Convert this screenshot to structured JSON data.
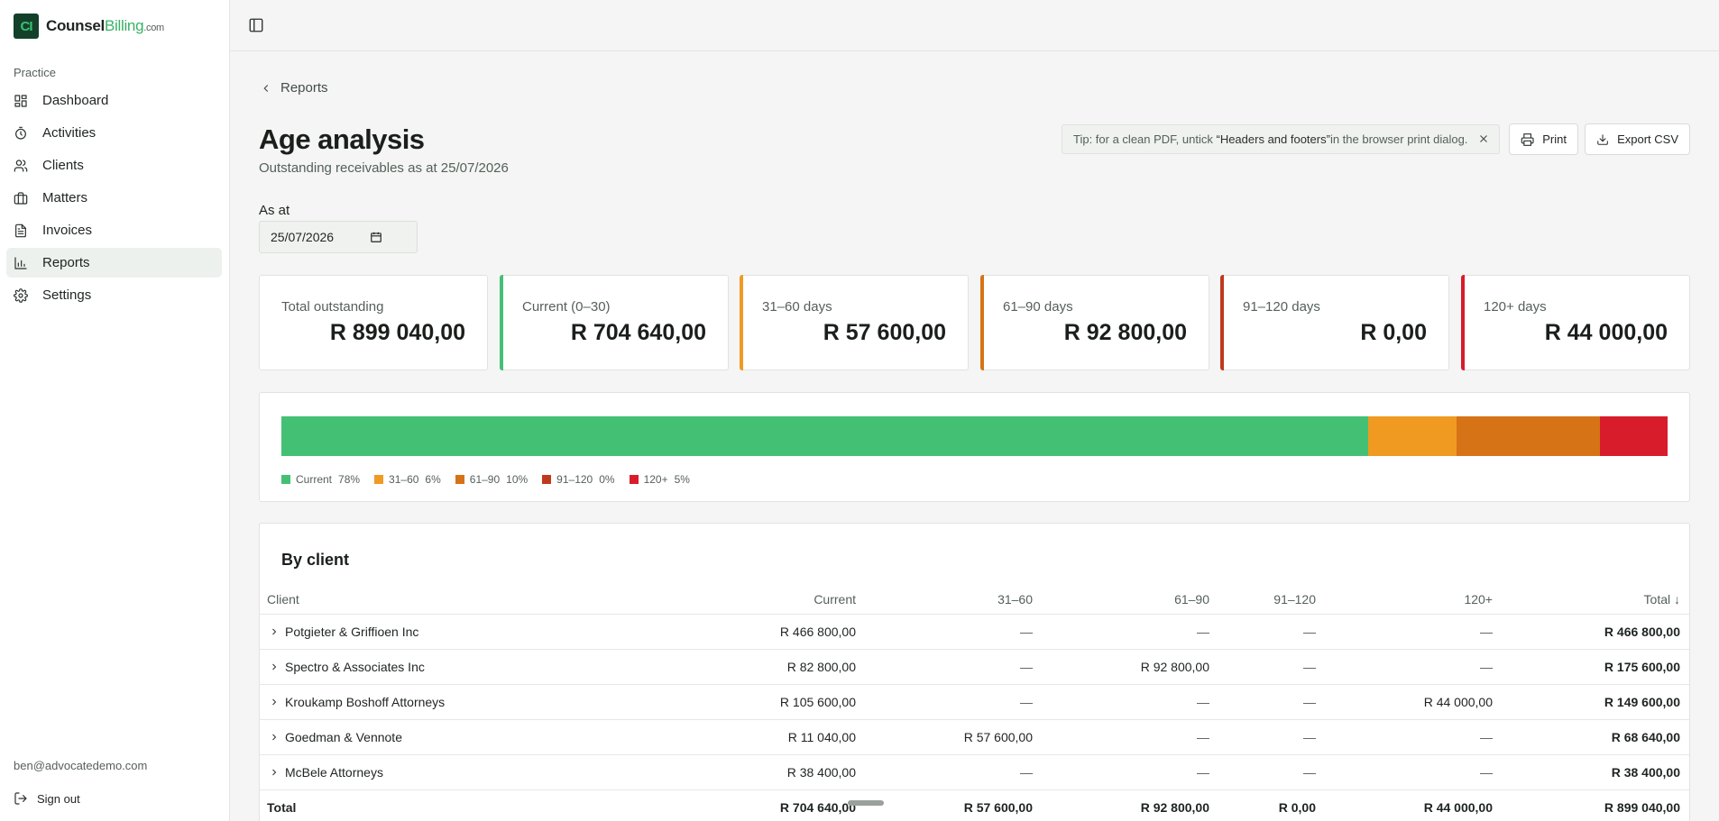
{
  "brand": {
    "mark": "CI",
    "name_part1": "Counsel",
    "name_part2": "Billing",
    "name_suffix": ".com"
  },
  "sidebar": {
    "section_label": "Practice",
    "items": [
      {
        "label": "Dashboard",
        "icon": "dashboard-icon"
      },
      {
        "label": "Activities",
        "icon": "stopwatch-icon"
      },
      {
        "label": "Clients",
        "icon": "users-icon"
      },
      {
        "label": "Matters",
        "icon": "briefcase-icon"
      },
      {
        "label": "Invoices",
        "icon": "document-icon"
      },
      {
        "label": "Reports",
        "icon": "bar-chart-icon",
        "active": true
      },
      {
        "label": "Settings",
        "icon": "gear-icon"
      }
    ],
    "user_email": "ben@advocatedemo.com",
    "signout_label": "Sign out"
  },
  "page": {
    "back_label": "Reports",
    "title": "Age analysis",
    "subtitle": "Outstanding receivables as at 25/07/2026",
    "tip_prefix": "Tip: for a clean PDF, untick ",
    "tip_highlight": "“Headers and footers”",
    "tip_suffix": " in the browser print dialog.",
    "print_label": "Print",
    "export_label": "Export CSV",
    "as_at_label": "As at",
    "as_at_value": "25/07/2026"
  },
  "summary_cards": [
    {
      "label": "Total outstanding",
      "value": "R 899 040,00",
      "color": ""
    },
    {
      "label": "Current (0–30)",
      "value": "R 704 640,00",
      "color": "#44c075"
    },
    {
      "label": "31–60 days",
      "value": "R 57 600,00",
      "color": "#f09a22"
    },
    {
      "label": "61–90 days",
      "value": "R 92 800,00",
      "color": "#d67316"
    },
    {
      "label": "91–120 days",
      "value": "R 0,00",
      "color": "#bf3a1c"
    },
    {
      "label": "120+ days",
      "value": "R 44 000,00",
      "color": "#d81c2c"
    }
  ],
  "chart_data": {
    "type": "bar",
    "stacked": true,
    "orientation": "horizontal",
    "categories": [
      "Current",
      "31–60",
      "61–90",
      "91–120",
      "120+"
    ],
    "values": [
      704640,
      57600,
      92800,
      0,
      44000
    ],
    "percent_labels": [
      "78%",
      "6%",
      "10%",
      "0%",
      "5%"
    ],
    "colors": [
      "#44c075",
      "#f09a22",
      "#d67316",
      "#bf3a1c",
      "#d81c2c"
    ],
    "legend_position": "bottom-left"
  },
  "table": {
    "title": "By client",
    "columns": [
      "Client",
      "Current",
      "31–60",
      "61–90",
      "91–120",
      "120+",
      "Total ↓"
    ],
    "rows": [
      {
        "client": "Potgieter & Griffioen Inc",
        "current": "R 466 800,00",
        "d31_60": "—",
        "d61_90": "—",
        "d91_120": "—",
        "d120": "—",
        "total": "R 466 800,00"
      },
      {
        "client": "Spectro & Associates Inc",
        "current": "R 82 800,00",
        "d31_60": "—",
        "d61_90": "R 92 800,00",
        "d91_120": "—",
        "d120": "—",
        "total": "R 175 600,00"
      },
      {
        "client": "Kroukamp Boshoff Attorneys",
        "current": "R 105 600,00",
        "d31_60": "—",
        "d61_90": "—",
        "d91_120": "—",
        "d120": "R 44 000,00",
        "total": "R 149 600,00"
      },
      {
        "client": "Goedman & Vennote",
        "current": "R 11 040,00",
        "d31_60": "R 57 600,00",
        "d61_90": "—",
        "d91_120": "—",
        "d120": "—",
        "total": "R 68 640,00"
      },
      {
        "client": "McBele Attorneys",
        "current": "R 38 400,00",
        "d31_60": "—",
        "d61_90": "—",
        "d91_120": "—",
        "d120": "—",
        "total": "R 38 400,00"
      }
    ],
    "total_row": {
      "client": "Total",
      "current": "R 704 640,00",
      "d31_60": "R 57 600,00",
      "d61_90": "R 92 800,00",
      "d91_120": "R 0,00",
      "d120": "R 44 000,00",
      "total": "R 899 040,00"
    }
  }
}
